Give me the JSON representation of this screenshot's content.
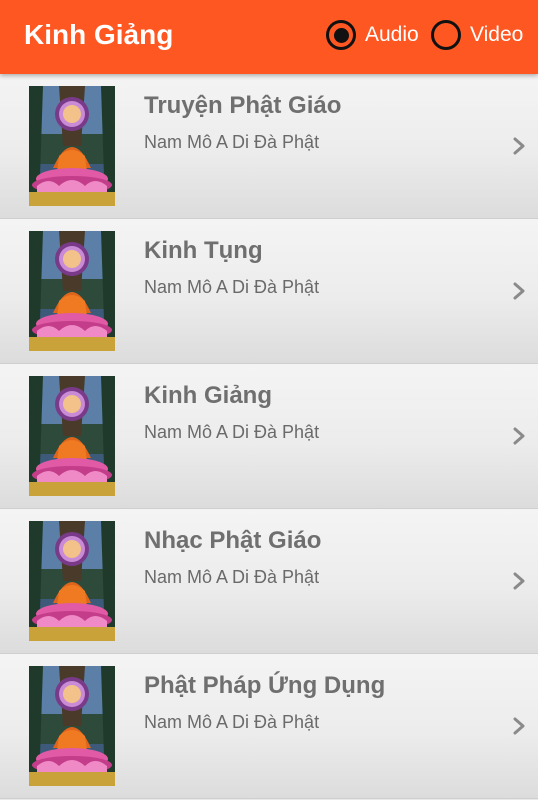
{
  "appbar": {
    "title": "Kinh Giảng",
    "color": "#ff5722",
    "options": [
      {
        "label": "Audio",
        "selected": true
      },
      {
        "label": "Video",
        "selected": false
      }
    ]
  },
  "list": {
    "items": [
      {
        "title": "Truyện Phật Giáo",
        "subtitle": "Nam Mô A Di Đà Phật",
        "icon": "buddha-thumbnail"
      },
      {
        "title": "Kinh Tụng",
        "subtitle": "Nam Mô A Di Đà Phật",
        "icon": "buddha-thumbnail"
      },
      {
        "title": "Kinh Giảng",
        "subtitle": "Nam Mô A Di Đà Phật",
        "icon": "buddha-thumbnail"
      },
      {
        "title": "Nhạc Phật Giáo",
        "subtitle": "Nam Mô A Di Đà Phật",
        "icon": "buddha-thumbnail"
      },
      {
        "title": "Phật Pháp Ứng Dụng",
        "subtitle": "Nam Mô A Di Đà Phật",
        "icon": "buddha-thumbnail"
      }
    ]
  }
}
